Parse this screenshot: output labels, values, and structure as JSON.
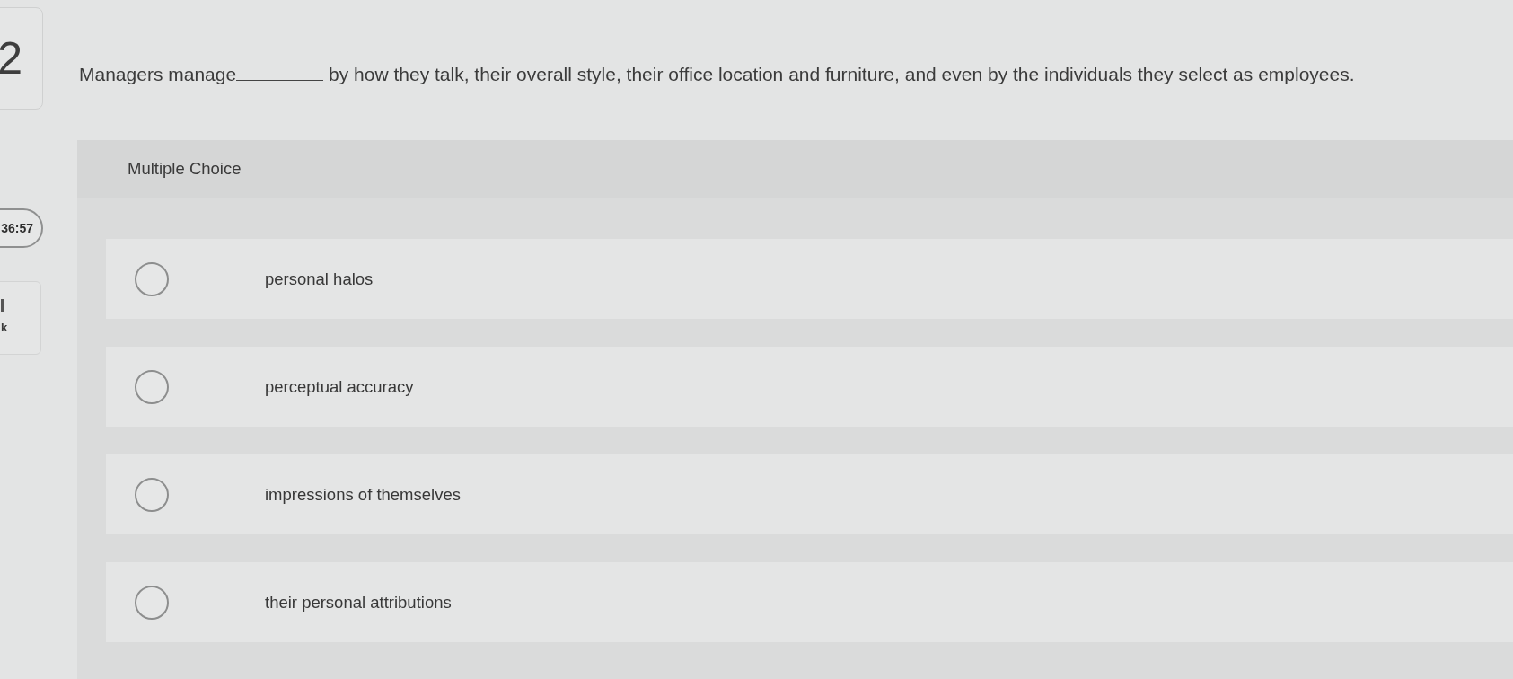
{
  "sidebar": {
    "question_number": "2",
    "timer": "36:57",
    "link_label": "k"
  },
  "question": {
    "prompt_before": "Managers manage",
    "prompt_after": "by how they talk, their overall style, their office location and furniture, and even by the individuals they select as employees."
  },
  "answer_panel": {
    "title": "Multiple Choice",
    "options": [
      {
        "label": "personal halos",
        "selected": false
      },
      {
        "label": "perceptual accuracy",
        "selected": false
      },
      {
        "label": "impressions of themselves",
        "selected": false
      },
      {
        "label": "their personal attributions",
        "selected": false
      }
    ]
  }
}
